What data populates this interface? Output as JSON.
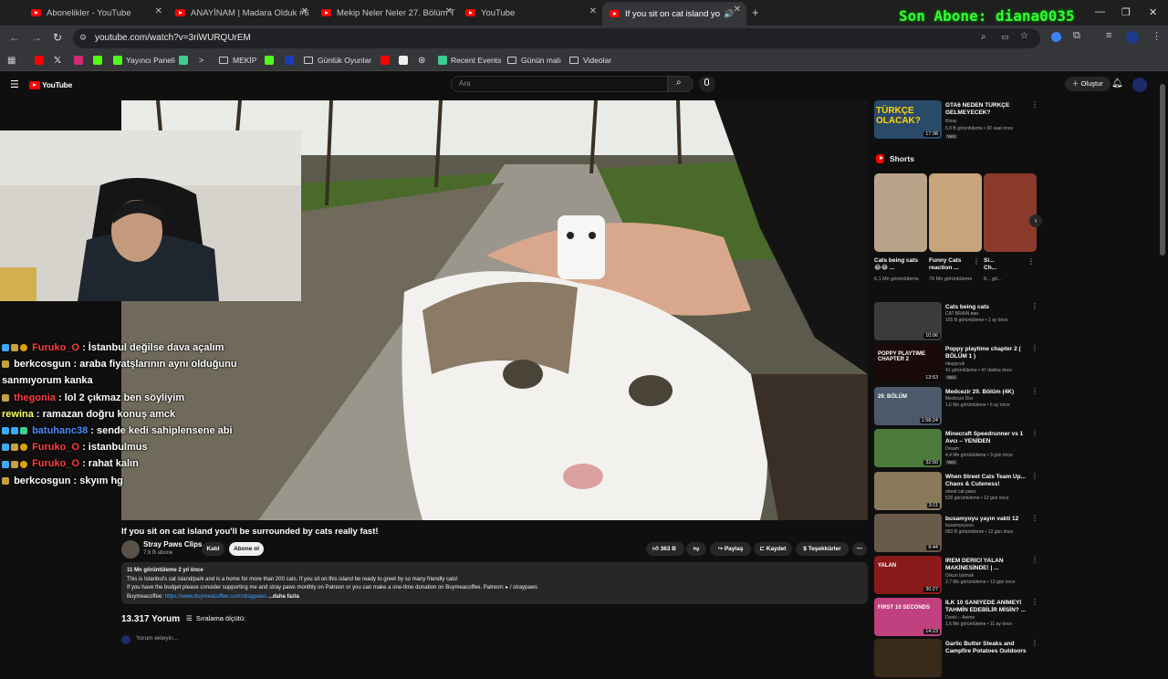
{
  "browser": {
    "tabs": [
      {
        "label": "Abonelikler - YouTube"
      },
      {
        "label": "ANAYİNAM | Madara Olduk #6"
      },
      {
        "label": "Mekip Neler Neler 27. Bölüm T"
      },
      {
        "label": "YouTube"
      },
      {
        "label": "If you sit on cat island you'l"
      }
    ],
    "url": "youtube.com/watch?v=3riWURQUrEM",
    "bookmarks": [
      "Yayıncı Paneli",
      "MEKİP",
      "Günlük Oyunlar",
      "Recent Events",
      "Günün malı",
      "Videolar"
    ]
  },
  "stream_overlay": {
    "banner": "Son Abone: diana0035"
  },
  "chat": [
    {
      "user": "Furuko_O",
      "color": "#ff4040",
      "msg": "İstanbul değilse dava açalım"
    },
    {
      "user": "berkcosgun",
      "color": "#ffffff",
      "msg": "araba fiyatşlarının aynı olduğunu sanmıyorum kanka"
    },
    {
      "user": "thegonia",
      "color": "#ff4040",
      "msg": "lol 2 çıkmaz ben söyliyim"
    },
    {
      "user": "rewina",
      "color": "#ffff66",
      "msg": "ramazan doğru konuş amck"
    },
    {
      "user": "batuhanc38",
      "color": "#4d8cff",
      "msg": "sende kedi sahiplensene abi"
    },
    {
      "user": "Furuko_O",
      "color": "#ff4040",
      "msg": "istanbulmus"
    },
    {
      "user": "Furuko_O",
      "color": "#ff4040",
      "msg": "rahat kalın"
    },
    {
      "user": "berkcosgun",
      "color": "#ffffff",
      "msg": "skyım hg"
    }
  ],
  "youtube": {
    "search_placeholder": "Ara",
    "create_label": "Oluştur",
    "video": {
      "title": "If you sit on cat island you'll be surrounded by cats really fast!",
      "channel": "Stray Paws Clips",
      "subs": "7,6 B abone",
      "join_label": "Katıl",
      "subscribe_label": "Abone ol",
      "likes": "363 B",
      "share_label": "Paylaş",
      "save_label": "Kaydet",
      "thanks_label": "Teşekkürler",
      "desc_stats": "11 Mn görüntüleme  2 yıl önce",
      "desc_line1": "This is Istanbul's cat island/park and is a home for more than 200 cats. If you sit on this island be ready to greet by so many friendly cats!",
      "desc_line2": "If you have the budget please consider supporting me and stray paws monthly on Patreon or you can make a one-time donation on Buymeacoffee. Patreon: ▸ / straypaws",
      "desc_line3_prefix": "Buymeacoffee: ",
      "desc_link": "https://www.buymeacoffee.com/straypaws",
      "desc_more": "...daha fazla",
      "comments_count": "13.317 Yorum",
      "sort_label": "Sıralama ölçütü:",
      "add_comment": "Yorum ekleyin..."
    },
    "top_rec": {
      "title": "GTA6 NEDEN TÜRKÇE GELMEYECEK?",
      "channel": "Kinay",
      "meta": "6,8 B görüntüleme • 30 saat önce",
      "duration": "17:38",
      "badge": "Yeni",
      "thumb_text": "TÜRKÇE OLACAK?"
    },
    "shorts_label": "Shorts",
    "shorts": [
      {
        "title": "Cats being cats 😂😂 ...",
        "meta": "6,1 Mn görüntüleme"
      },
      {
        "title": "Funny Cats reaction ...",
        "meta": "79 Mn görüntüleme"
      },
      {
        "title": "Si... Ch...",
        "meta": "8... gö..."
      }
    ],
    "recs": [
      {
        "title": "Cats being cats",
        "channel": "CAT BRAIN ᴎᴎᴎ",
        "meta": "155 B görüntüleme • 1 ay önce",
        "duration": "10:06",
        "badge": "",
        "thumb": "#3b3b3b"
      },
      {
        "title": "Poppy playtime chapter 2 ( BÖLÜM 1 )",
        "channel": "rikaypcuk",
        "meta": "41 görüntüleme • 47 dakika önce",
        "duration": "13:53",
        "badge": "Yeni",
        "thumb": "#1a0a0a",
        "thumb_text": "POPPY PLAYTIME CHAPTER 2"
      },
      {
        "title": "Medcezir 29. Bölüm (4K)",
        "channel": "Medcezir Dizi",
        "meta": "1,6 Mn görüntüleme • 6 ay önce",
        "duration": "1:58:24",
        "badge": "",
        "thumb": "#4a5a6a",
        "thumb_text": "29. BÖLÜM"
      },
      {
        "title": "Minecraft Speedrunner vs 1 Avcı – YENİDEN",
        "channel": "Dream",
        "meta": "4,4 Mn görüntüleme • 3 gün önce",
        "duration": "32:50",
        "badge": "Yeni",
        "thumb": "#4c7a3a"
      },
      {
        "title": "When Street Cats Team Up... Chaos & Cuteness!",
        "channel": "street cat paws",
        "meta": "526 görüntüleme • 12 gün önce",
        "duration": "3:11",
        "badge": "",
        "thumb": "#8a7a5a"
      },
      {
        "title": "busamyoyu yayın vakti 12",
        "channel": "busamyoyuvu",
        "meta": "583 B görüntüleme • 12 gün önce",
        "duration": "9:44",
        "badge": "",
        "thumb": "#6a5a4a"
      },
      {
        "title": "İREM DERİCİ YALAN MAKİNESİNDE! | ...",
        "channel": "Orkun Işıtmak",
        "meta": "2,7 Mn görüntüleme • 13 gün önce",
        "duration": "30:27",
        "badge": "",
        "thumb": "#8a1a1a",
        "thumb_text": "YALAN"
      },
      {
        "title": "İLK 10 SANİYEDE ANİMEYİ TAHMİN EDEBİLİR MİSİN? ...",
        "channel": "Donki – Anime",
        "meta": "1,6 Mn görüntüleme • 11 ay önce",
        "duration": "14:23",
        "badge": "",
        "thumb": "#c04080",
        "thumb_text": "FIRST 10 SECONDS"
      },
      {
        "title": "Garlic Butter Steaks and Campfire Potatoes Outdoors",
        "channel": "",
        "meta": "",
        "duration": "",
        "badge": "",
        "thumb": "#3a2a1a"
      }
    ]
  }
}
